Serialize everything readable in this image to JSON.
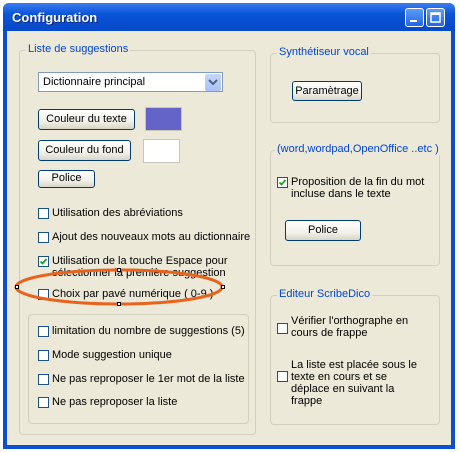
{
  "window": {
    "title": "Configuration"
  },
  "suggestions": {
    "legend": "Liste de suggestions",
    "dictionary_select": "Dictionnaire principal",
    "text_color_button": "Couleur du texte",
    "text_color": "#6464c8",
    "bg_color_button": "Couleur du fond",
    "bg_color": "#ffffff",
    "font_button": "Police",
    "options": [
      {
        "label": "Utilisation des abréviations",
        "checked": false
      },
      {
        "label": "Ajout des nouveaux mots au dictionnaire",
        "checked": false
      },
      {
        "label": "Utilisation de  la  touche Espace pour sélectionner la première suggestion",
        "checked": true
      },
      {
        "label": "Choix par pavé numérique ( 0-9 )",
        "checked": false
      }
    ],
    "sub_options": [
      {
        "label": "limitation du  nombre de suggestions (5)",
        "checked": false
      },
      {
        "label": "Mode suggestion unique",
        "checked": false
      },
      {
        "label": "Ne pas reproposer le 1er mot de la liste",
        "checked": false
      },
      {
        "label": "Ne pas reproposer la liste",
        "checked": false
      }
    ]
  },
  "synth": {
    "legend": "Synthétiseur vocal",
    "settings_button": "Paramètrage"
  },
  "editors": {
    "legend": "(word,wordpad,OpenOffice ..etc )",
    "completion_option": {
      "label": "Proposition de la fin  du mot incluse dans le texte",
      "checked": true
    },
    "font_button": "Police"
  },
  "scribedico": {
    "legend": "Editeur ScribeDico",
    "options": [
      {
        "label": "Vérifier l'orthographe en cours de frappe",
        "checked": false
      },
      {
        "label": "La liste est placée sous le texte en cours et se déplace en suivant la frappe",
        "checked": false
      }
    ]
  },
  "annotation": {
    "color": "#e8641e"
  }
}
